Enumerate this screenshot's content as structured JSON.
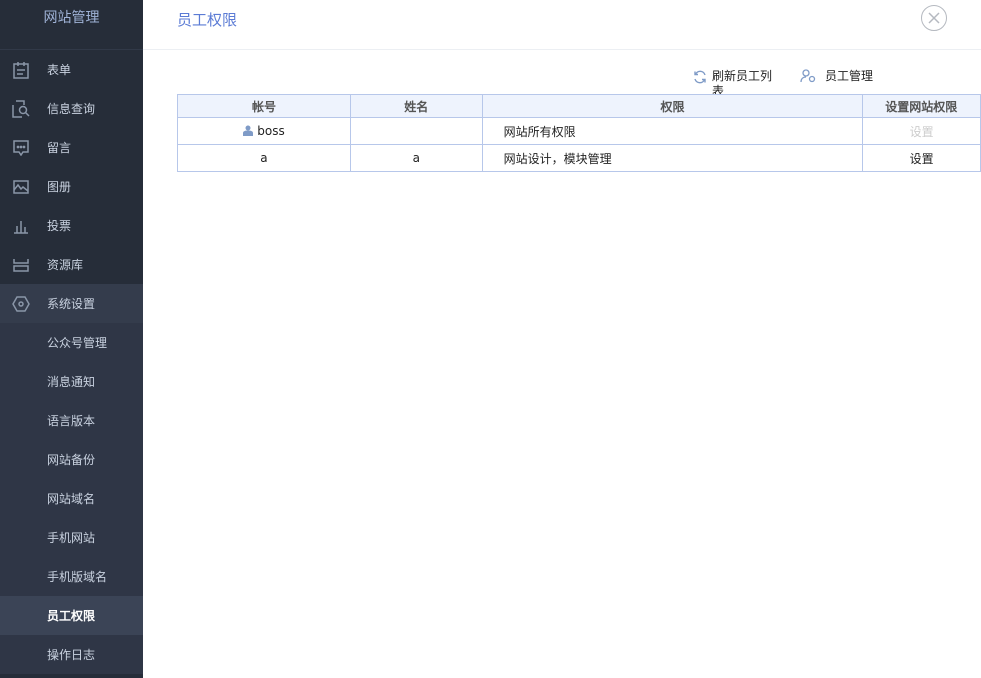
{
  "sidebar": {
    "brand": "网站管理",
    "items": [
      {
        "label": "表单",
        "icon": "form-icon"
      },
      {
        "label": "信息查询",
        "icon": "search-doc-icon"
      },
      {
        "label": "留言",
        "icon": "message-icon"
      },
      {
        "label": "图册",
        "icon": "gallery-icon"
      },
      {
        "label": "投票",
        "icon": "bar-chart-icon"
      },
      {
        "label": "资源库",
        "icon": "storage-icon"
      },
      {
        "label": "系统设置",
        "icon": "settings-icon"
      }
    ],
    "sub_items": [
      {
        "label": "公众号管理"
      },
      {
        "label": "消息通知"
      },
      {
        "label": "语言版本"
      },
      {
        "label": "网站备份"
      },
      {
        "label": "网站域名"
      },
      {
        "label": "手机网站"
      },
      {
        "label": "手机版域名"
      },
      {
        "label": "员工权限",
        "active": true
      },
      {
        "label": "操作日志"
      }
    ]
  },
  "header": {
    "title": "员工权限"
  },
  "toolbar": {
    "refresh_label": "刷新员工列表",
    "manage_label": "员工管理"
  },
  "table": {
    "columns": [
      "帐号",
      "姓名",
      "权限",
      "设置网站权限"
    ],
    "rows": [
      {
        "account": "boss",
        "name": "",
        "permission": "网站所有权限",
        "action": "设置",
        "action_disabled": true,
        "owner_icon": true
      },
      {
        "account": "a",
        "name": "a",
        "permission": "网站设计，模块管理",
        "action": "设置",
        "action_disabled": false
      }
    ]
  },
  "colors": {
    "sidebar_bg": "#262d39",
    "accent": "#5b7bd5",
    "table_border": "#b7c7ea",
    "header_bg": "#eef3fd"
  }
}
